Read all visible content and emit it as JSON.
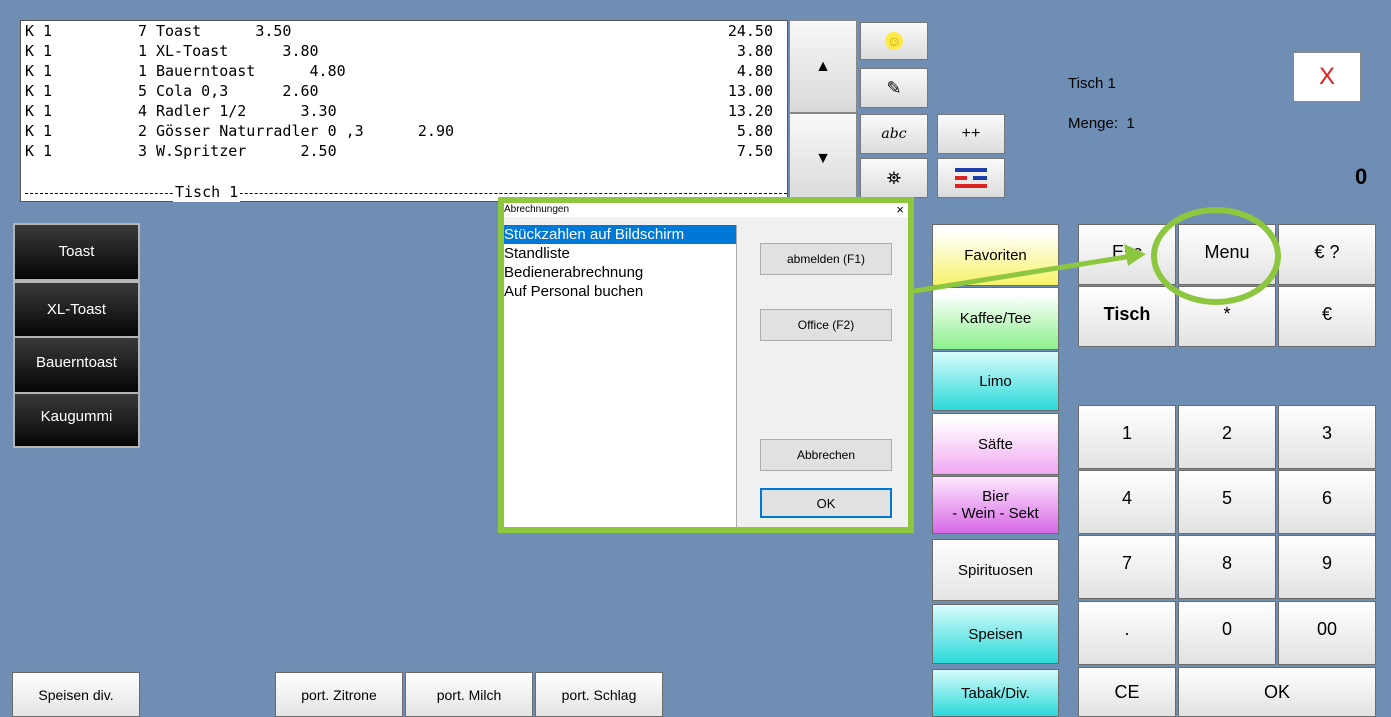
{
  "order_list": {
    "rows": [
      {
        "k": "K 1",
        "qty": "7",
        "name": "Toast      3.50",
        "total": "24.50"
      },
      {
        "k": "K 1",
        "qty": "1",
        "name": "XL-Toast      3.80",
        "total": "3.80"
      },
      {
        "k": "K 1",
        "qty": "1",
        "name": "Bauerntoast      4.80",
        "total": "4.80"
      },
      {
        "k": "K 1",
        "qty": "5",
        "name": "Cola 0,3      2.60",
        "total": "13.00"
      },
      {
        "k": "K 1",
        "qty": "4",
        "name": "Radler 1/2      3.30",
        "total": "13.20"
      },
      {
        "k": "K 1",
        "qty": "2",
        "name": "Gösser Naturradler 0 ,3      2.90",
        "total": "5.80"
      },
      {
        "k": "K 1",
        "qty": "3",
        "name": "W.Spritzer      2.50",
        "total": "7.50"
      }
    ],
    "separator_label": "Tisch 1"
  },
  "scroll": {
    "up": "▲",
    "down": "▼"
  },
  "icons": {
    "smiley": "☺",
    "note": "✎",
    "abc": "abc",
    "plusplus": "++",
    "binoculars": "⛯",
    "flag": "≡"
  },
  "info": {
    "table": "Tisch 1",
    "quantity": "Menge:  1",
    "amount": "0",
    "close": "X"
  },
  "left_buttons": [
    "Toast",
    "XL-Toast",
    "Bauerntoast",
    "Kaugummi"
  ],
  "categories": [
    "Favoriten",
    "Kaffee/Tee",
    "Limo",
    "Säfte",
    "Bier\n- Wein - Sekt",
    "Spirituosen",
    "Speisen",
    "Tabak/Div."
  ],
  "keypad": {
    "esc": "Esc",
    "menu": "Menu",
    "euro_q": "€ ?",
    "tisch": "Tisch",
    "star": "*",
    "euro": "€",
    "k1": "1",
    "k2": "2",
    "k3": "3",
    "k4": "4",
    "k5": "5",
    "k6": "6",
    "k7": "7",
    "k8": "8",
    "k9": "9",
    "dot": ".",
    "k0": "0",
    "k00": "00",
    "ce": "CE",
    "ok": "OK"
  },
  "bottom_buttons": [
    "Speisen div.",
    "port. Zitrone",
    "port. Milch",
    "port. Schlag"
  ],
  "dialog": {
    "title": "Abrechnungen",
    "close": "×",
    "items": [
      "Stückzahlen auf Bildschirm",
      "Standliste",
      "Bedienerabrechnung",
      "Auf Personal buchen"
    ],
    "btn_logout": "abmelden (F1)",
    "btn_office": "Office (F2)",
    "btn_cancel": "Abbrechen",
    "btn_ok": "OK"
  },
  "highlight_color": "#8dc63f"
}
